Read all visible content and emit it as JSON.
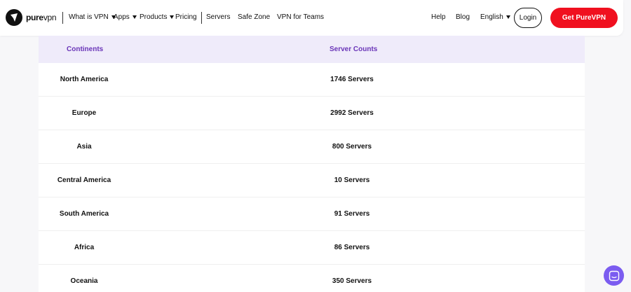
{
  "brand": {
    "name_bold": "pure",
    "name_light": "vpn"
  },
  "nav": {
    "items": [
      {
        "label": "What is VPN",
        "has_dropdown": true
      },
      {
        "label": "Apps",
        "has_dropdown": true
      },
      {
        "label": "Products",
        "has_dropdown": true
      },
      {
        "label": "Pricing",
        "has_dropdown": false
      },
      {
        "label": "Servers",
        "has_dropdown": false
      },
      {
        "label": "Safe Zone",
        "has_dropdown": false
      },
      {
        "label": "VPN for Teams",
        "has_dropdown": false
      }
    ],
    "right": {
      "help": "Help",
      "blog": "Blog",
      "language": "English",
      "login": "Login",
      "cta": "Get PureVPN"
    }
  },
  "table": {
    "headers": {
      "continent": "Continents",
      "servers": "Server Counts"
    },
    "rows": [
      {
        "continent": "North America",
        "servers": "1746 Servers"
      },
      {
        "continent": "Europe",
        "servers": "2992 Servers"
      },
      {
        "continent": "Asia",
        "servers": "800 Servers"
      },
      {
        "continent": "Central America",
        "servers": "10 Servers"
      },
      {
        "continent": "South America",
        "servers": "91 Servers"
      },
      {
        "continent": "Africa",
        "servers": "86 Servers"
      },
      {
        "continent": "Oceania",
        "servers": "350 Servers"
      }
    ]
  },
  "colors": {
    "accent": "#f0101f",
    "header_text": "#6a35b8",
    "header_bg": "#efebfa",
    "chat": "#7b5cf0"
  },
  "icons": {
    "logo": "shield-logo-icon",
    "chat": "chat-icon",
    "dropdown": "caret-down-icon"
  }
}
